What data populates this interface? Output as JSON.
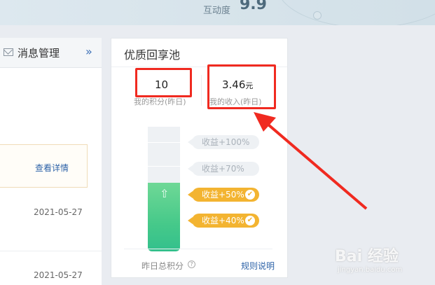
{
  "banner": {
    "label": "互动度",
    "score": "9.9"
  },
  "left_panel": {
    "title": "消息管理",
    "detail_link": "查看详情",
    "dates": [
      "2021-05-27",
      "2021-05-27"
    ]
  },
  "pool_card": {
    "title": "优质回享池",
    "points": {
      "value": "10",
      "label": "我的积分(昨日)"
    },
    "income": {
      "value": "3.46",
      "unit": "元",
      "label": "我的收入(昨日)"
    },
    "fill_fraction": 0.55,
    "tiers": [
      {
        "label": "收益+100%",
        "reached": false
      },
      {
        "label": "收益+70%",
        "reached": false
      },
      {
        "label": "收益+50%",
        "reached": true
      },
      {
        "label": "收益+40%",
        "reached": true
      }
    ],
    "footer_label": "昨日总积分",
    "rules_link": "规则说明"
  },
  "colors": {
    "accent_green": "#46c98a",
    "tier_gold": "#f3b431",
    "annotation_red": "#f02a20",
    "link_blue": "#2e63a8"
  },
  "icons": [
    "mail-icon",
    "chevron-right-icon",
    "up-arrow-icon",
    "check-icon",
    "help-icon"
  ],
  "watermark": {
    "brand": "Bai 经验",
    "url": "jingyan.baidu.com"
  }
}
